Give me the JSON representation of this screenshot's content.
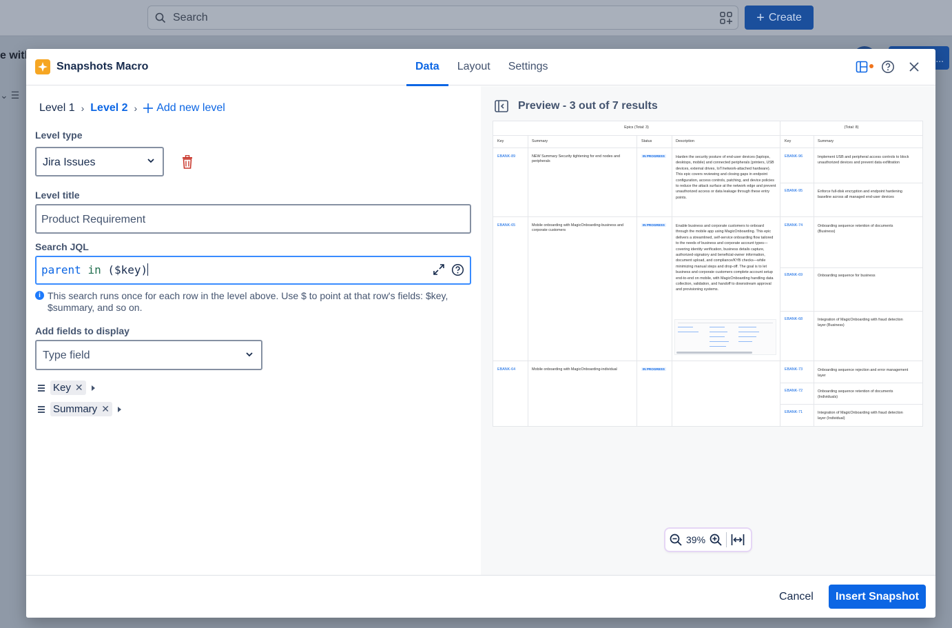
{
  "background": {
    "search_placeholder": "Search",
    "create_label": "Create",
    "page_word": "e with",
    "right_button_label": "..."
  },
  "modal": {
    "title": "Snapshots Macro",
    "tabs": [
      "Data",
      "Layout",
      "Settings"
    ],
    "active_tab": "Data"
  },
  "config": {
    "breadcrumb": [
      "Level 1",
      "Level 2"
    ],
    "add_level_label": "Add new level",
    "level_type_label": "Level type",
    "level_type_value": "Jira Issues",
    "level_title_label": "Level title",
    "level_title_placeholder": "Product Requirement",
    "search_jql_label": "Search JQL",
    "jql_keyword": "parent",
    "jql_operator": "in",
    "jql_value": "($key)",
    "hint": "This search runs once for each row in the level above. Use $ to point at that row's fields: $key, $summary, and so on.",
    "fields_label": "Add fields to display",
    "fields_placeholder": "Type field",
    "chips": [
      "Key",
      "Summary"
    ]
  },
  "preview": {
    "title": "Preview - 3 out of 7 results",
    "group_left": "Epics (Total: 3)",
    "group_right": "(Total: 8)",
    "columns_left": [
      "Key",
      "Summary",
      "Status",
      "Description"
    ],
    "columns_right": [
      "Key",
      "Summary"
    ],
    "rows": [
      {
        "key": "EBANK-89",
        "summary": "NEW Summary Security tightening for end nodes and peripherals",
        "status": "IN PROGRESS",
        "description": "Harden the security posture of end-user devices (laptops, desktops, mobile) and connected peripherals (printers, USB devices, external drives, IoT/network-attached hardware). This epic covers reviewing and closing gaps in endpoint configuration, access controls, patching, and device policies to reduce the attack surface at the network edge and prevent unauthorized access or data leakage through these entry points.",
        "children": [
          {
            "key": "EBANK-96",
            "summary": "Implement USB and peripheral access controls to block unauthorized devices and prevent data exfiltration"
          },
          {
            "key": "EBANK-95",
            "summary": "Enforce full-disk encryption and endpoint hardening baseline across all managed end-user devices"
          }
        ]
      },
      {
        "key": "EBANK-65",
        "summary": "Mobile onboarding with MagicOnboarding-business and corporate customers",
        "status": "IN PROGRESS",
        "description": "Enable business and corporate customers to onboard through the mobile app using MagicOnboarding. This epic delivers a streamlined, self-service onboarding flow tailored to the needs of business and corporate account types—covering identity verification, business details capture, authorized-signatory and beneficial-owner information, document upload, and compliance/KYB checks—while minimizing manual steps and drop-off. The goal is to let business and corporate customers complete account setup end-to-end on mobile, with MagicOnboarding handling data collection, validation, and handoff to downstream approval and provisioning systems.",
        "children": [
          {
            "key": "EBANK-74",
            "summary": "Onboarding sequence retention of documents (Business)"
          },
          {
            "key": "EBANK-69",
            "summary": "Onboarding sequence for business"
          },
          {
            "key": "EBANK-68",
            "summary": "Integration of MagicOnboarding with fraud detection layer (Business)"
          }
        ]
      },
      {
        "key": "EBANK-64",
        "summary": "Mobile onboarding with MagicOnboarding-individual",
        "status": "IN PROGRESS",
        "description": "",
        "children": [
          {
            "key": "EBANK-73",
            "summary": "Onboarding sequence rejection and error management layer"
          },
          {
            "key": "EBANK-72",
            "summary": "Onboarding sequence retention of documents (Individuals)"
          },
          {
            "key": "EBANK-71",
            "summary": "Integration of MagicOnboarding with fraud detection layer (Individual)"
          }
        ]
      }
    ],
    "zoom_label": "39%"
  },
  "footer": {
    "cancel_label": "Cancel",
    "insert_label": "Insert Snapshot"
  },
  "colors": {
    "accent": "#0c66e4",
    "logo": "#f6a623",
    "danger": "#c9372c"
  }
}
